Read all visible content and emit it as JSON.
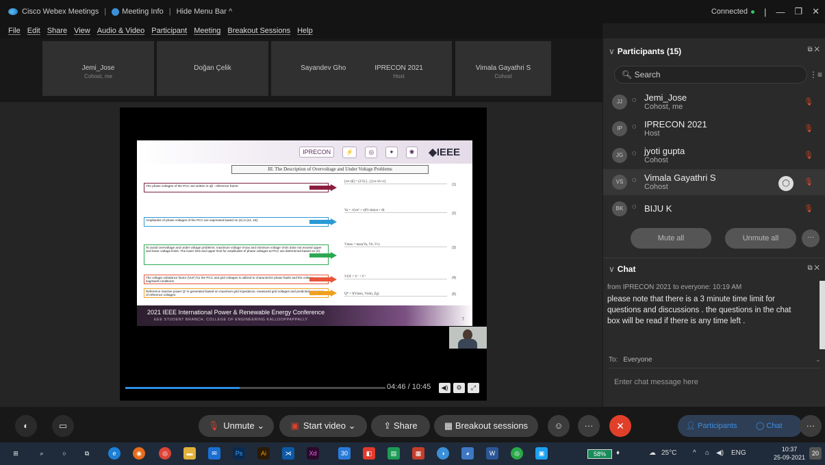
{
  "titlebar": {
    "app_name": "Cisco Webex Meetings",
    "meeting_info": "Meeting Info",
    "hide_menu": "Hide Menu Bar ^",
    "connected": "Connected"
  },
  "menu": [
    "File",
    "Edit",
    "Share",
    "View",
    "Audio & Video",
    "Participant",
    "Meeting",
    "Breakout Sessions",
    "Help"
  ],
  "thumbnails": [
    {
      "name": "Jemi_Jose",
      "role": "Cohost, me"
    },
    {
      "name": "Doğan Çelik",
      "role": ""
    },
    {
      "name": "Sayandev Ghosh",
      "role": ""
    },
    {
      "name": "IPRECON 2021",
      "role": "Host"
    },
    {
      "name": "Vimala Gayathri S",
      "role": "Cohost"
    }
  ],
  "slide": {
    "logos": [
      "IPRECON",
      "IEEE"
    ],
    "title": "III. The Description of Overvoltage and Under Voltage Problems",
    "rows": [
      "The phase voltages of the PCC are written in αβ - reference frame:",
      "Amplitudes of phase voltages of the PCC are expressed based on (2) in [14, 15]:",
      "To avoid overvoltage and under voltage problems, maximum voltage Vmax and minimum voltage Vmin dose not exceed upper and lower voltage limits. The lower limit and upper limit for amplitudes of phase voltages at PCC are determined based on (4):",
      "The voltage unbalance factor (VUF) for the PCC and grid voltages is utilized to characterize phase faults and the voltage sag/swell conditions:",
      "Reference reactive power Q* is generated based on maximum grid impedance, measured grid voltages and predicted sequence of reference voltages:"
    ],
    "equations": [
      "[vα vβ] = (2/3)·[...]·[va vb vc]",
      "Va = √(vα² + vβ²)·sin(ωt + θ)",
      "Vmax = max(Va, Vb, Vc)",
      "VUF = V⁻ / V⁺",
      "Q* = f(Vmax, Vmin, Zg)"
    ],
    "eq_numbers": [
      "(1)",
      "(2)",
      "(3)",
      "(4)",
      "(5)"
    ],
    "footer_title": "2021 IEEE International Power & Renewable Energy Conference",
    "footer_sub": "EEE STUDENT BRANCH, COLLEGE OF ENGINEERING KALLOOPPAPPALLY",
    "page": "7"
  },
  "video": {
    "time": "04:46 / 10:45",
    "progress": 0.44
  },
  "participants": {
    "header": "Participants (15)",
    "search_placeholder": "Search",
    "list": [
      {
        "initials": "JJ",
        "name": "Jemi_Jose",
        "role": "Cohost, me"
      },
      {
        "initials": "IP",
        "name": "IPRECON 2021",
        "role": "Host"
      },
      {
        "initials": "JG",
        "name": "jyoti gupta",
        "role": "Cohost"
      },
      {
        "initials": "VS",
        "name": "Vimala Gayathri S",
        "role": "Cohost"
      },
      {
        "initials": "BK",
        "name": "BIJU K",
        "role": ""
      }
    ],
    "mute_all": "Mute all",
    "unmute_all": "Unmute all"
  },
  "chat": {
    "header": "Chat",
    "from": "from IPRECON 2021 to everyone:   10:19 AM",
    "message": "please note that there is a 3 minute time limit for questions and discussions . the questions in the chat box will be read if there is any time left .",
    "to_label": "To:",
    "to_value": "Everyone",
    "input_placeholder": "Enter chat message here"
  },
  "controls": {
    "unmute": "Unmute",
    "start_video": "Start video",
    "share": "Share",
    "breakout": "Breakout sessions",
    "participants": "Participants",
    "chat": "Chat"
  },
  "taskbar": {
    "battery": "58%",
    "temp": "25°C",
    "lang": "ENG",
    "time": "10:37",
    "date": "25-09-2021",
    "badge_30": "30",
    "notif_count": "20"
  }
}
